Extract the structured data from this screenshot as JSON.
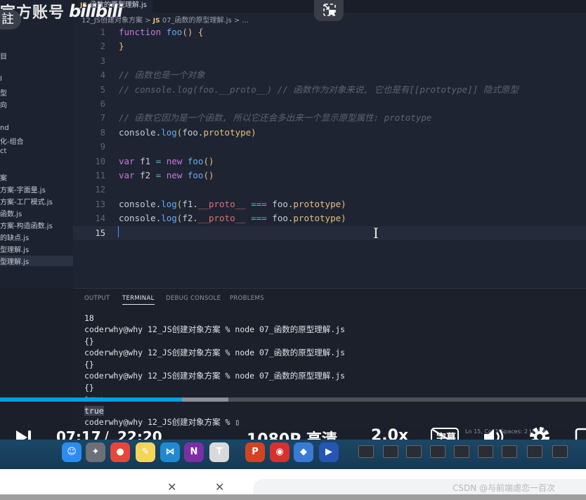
{
  "watermark": {
    "text": "官方账号",
    "badge": "註",
    "logo": "bilibili"
  },
  "sidebar": {
    "fragments": [
      "目",
      "I",
      "型",
      "向",
      "nd",
      "化-组合",
      "ct",
      "案",
      "方案-字面量.js",
      "方案-工厂模式.js",
      "函数.js",
      "方案-构造函数.js",
      "的缺点.js",
      "型理解.js",
      "型理解.js"
    ]
  },
  "editor": {
    "tab": {
      "prefix": "JS",
      "label": "函数的原型理解.js"
    },
    "breadcrumb": {
      "folder": "12_JS创建对象方案",
      "sep": ">",
      "prefix": "JS",
      "file": "07_函数的原型理解.js",
      "tail": "> ..."
    },
    "current_line": 15
  },
  "panel": {
    "tabs": [
      "OUTPUT",
      "TERMINAL",
      "DEBUG CONSOLE",
      "PROBLEMS"
    ],
    "active_tab": "TERMINAL",
    "terminal_lines": [
      "18",
      "coderwhy@why 12_JS创建对象方案 % node 07_函数的原型理解.js",
      "{}",
      "coderwhy@why 12_JS创建对象方案 % node 07_函数的原型理解.js",
      "{}",
      "coderwhy@why 12_JS创建对象方案 % node 07_函数的原型理解.js",
      "{}",
      "true",
      "true",
      "coderwhy@why 12_JS创建对象方案 % ▯"
    ]
  },
  "player": {
    "time_current": "07:17",
    "time_separator": "/",
    "time_total": "22:20",
    "quality": "1080P 高清",
    "speed": "2.0x",
    "subtitle_label": "字幕",
    "progress_played": 0.31,
    "progress_buffered": 0.39,
    "status_text": "Ln 15, Col 1   Spaces: 2   UTF-8"
  },
  "dock": {
    "apps": [
      {
        "name": "finder",
        "label": "☺",
        "color": "#2d8cf0"
      },
      {
        "name": "launchpad",
        "label": "✦",
        "color": "#6b6f78"
      },
      {
        "name": "chrome",
        "label": "●",
        "color": "#e8453c"
      },
      {
        "name": "notes",
        "label": "✎",
        "color": "#f5d45b"
      },
      {
        "name": "vscode",
        "label": "⋈",
        "color": "#1f8ad2"
      },
      {
        "name": "onenote",
        "label": "N",
        "color": "#7b2fa7"
      },
      {
        "name": "typora",
        "label": "T",
        "color": "#d9d9d9"
      },
      {
        "name": "powerpoint",
        "label": "P",
        "color": "#d04423"
      },
      {
        "name": "netease",
        "label": "◉",
        "color": "#d8302f"
      },
      {
        "name": "app-blue",
        "label": "◆",
        "color": "#3a7bd5"
      },
      {
        "name": "app-video",
        "label": "▶",
        "color": "#2456b4"
      }
    ]
  },
  "footer": {
    "credit": "CSDN @与前端虐恋一百次",
    "x_mark": "✕"
  }
}
